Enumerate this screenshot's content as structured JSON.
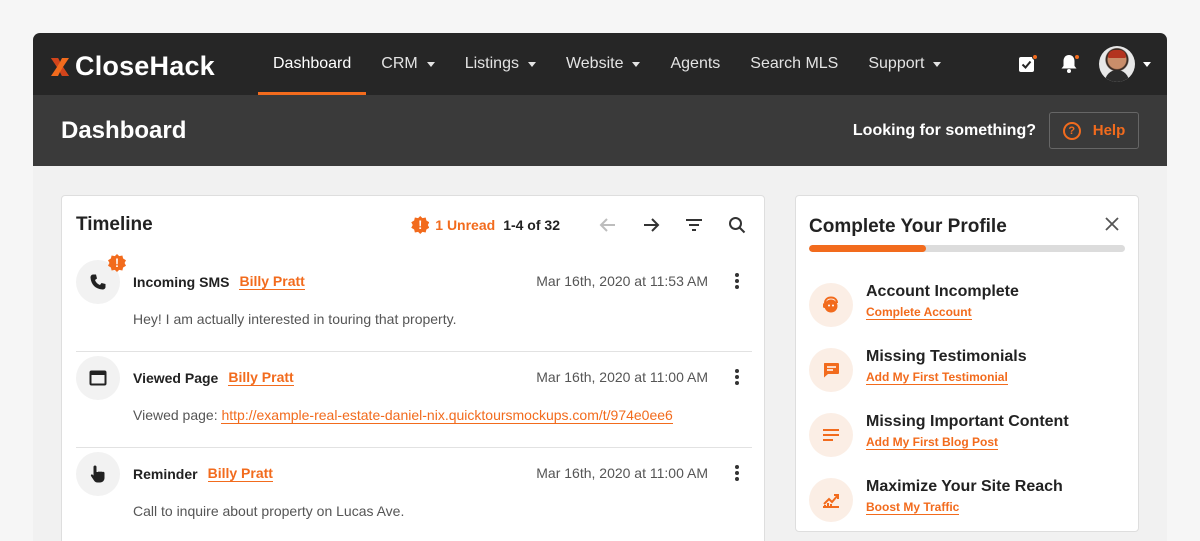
{
  "brand": {
    "name": "CloseHack",
    "accent": "#f26b1d"
  },
  "nav": {
    "items": [
      {
        "label": "Dashboard",
        "active": true,
        "caret": false
      },
      {
        "label": "CRM",
        "active": false,
        "caret": true
      },
      {
        "label": "Listings",
        "active": false,
        "caret": true
      },
      {
        "label": "Website",
        "active": false,
        "caret": true
      },
      {
        "label": "Agents",
        "active": false,
        "caret": false
      },
      {
        "label": "Search MLS",
        "active": false,
        "caret": false
      },
      {
        "label": "Support",
        "active": false,
        "caret": true
      }
    ],
    "icons": [
      "task-check-icon",
      "bell-icon",
      "avatar"
    ]
  },
  "subheader": {
    "title": "Dashboard",
    "looking": "Looking for something?",
    "help_label": "Help",
    "help_glyph": "?"
  },
  "timeline": {
    "title": "Timeline",
    "unread_glyph": "!",
    "unread": "1 Unread",
    "range": "1-4 of 32",
    "items": [
      {
        "icon": "phone-icon",
        "alert": "!",
        "type": "Incoming SMS",
        "person": "Billy Pratt",
        "date": "Mar 16th, 2020 at 11:53 AM",
        "body": "Hey! I am actually interested in touring that property.",
        "link": ""
      },
      {
        "icon": "browser-window-icon",
        "type": "Viewed Page",
        "person": "Billy Pratt",
        "date": "Mar 16th, 2020 at 11:00 AM",
        "body": "Viewed page: ",
        "link": "http://example-real-estate-daniel-nix.quicktoursmockups.com/t/974e0ee6"
      },
      {
        "icon": "hand-pointer-icon",
        "type": "Reminder",
        "person": "Billy Pratt",
        "date": "Mar 16th, 2020 at 11:00 AM",
        "body": "Call to inquire about property on Lucas Ave.",
        "link": ""
      }
    ]
  },
  "profile": {
    "title": "Complete Your Profile",
    "progress": 0.37,
    "items": [
      {
        "icon": "face-icon",
        "heading": "Account Incomplete",
        "link": "Complete Account"
      },
      {
        "icon": "message-icon",
        "heading": "Missing Testimonials",
        "link": "Add My First Testimonial"
      },
      {
        "icon": "text-lines-icon",
        "heading": "Missing Important Content",
        "link": "Add My First Blog Post"
      },
      {
        "icon": "traffic-chart-icon",
        "heading": "Maximize Your Site Reach",
        "link": "Boost My Traffic"
      }
    ]
  }
}
